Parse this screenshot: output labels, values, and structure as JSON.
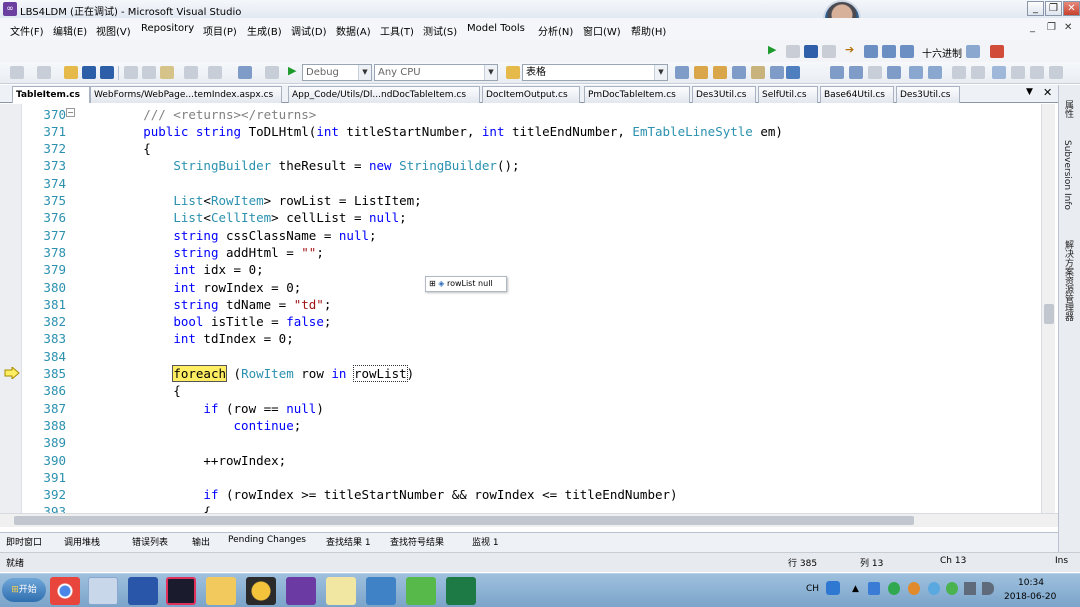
{
  "window": {
    "title": "LBS4LDM (正在调试) - Microsoft Visual Studio",
    "controls": [
      "_",
      "❐",
      "✕"
    ],
    "inner_controls": [
      "_",
      "❐",
      "✕"
    ]
  },
  "menu": [
    "文件(F)",
    "编辑(E)",
    "视图(V)",
    "Repository",
    "项目(P)",
    "生成(B)",
    "调试(D)",
    "数据(A)",
    "工具(T)",
    "测试(S)",
    "Model Tools",
    "分析(N)",
    "窗口(W)",
    "帮助(H)"
  ],
  "toolbar1": {
    "hex_label": "十六进制"
  },
  "toolbar2": {
    "config": "Debug",
    "platform": "Any CPU",
    "find_value": "表格"
  },
  "tabs": [
    {
      "label": "TableItem.cs",
      "active": true
    },
    {
      "label": "WebForms/WebPage...temIndex.aspx.cs"
    },
    {
      "label": "App_Code/Utils/Dl...ndDocTableItem.cs"
    },
    {
      "label": "DocItemOutput.cs"
    },
    {
      "label": "PmDocTableItem.cs"
    },
    {
      "label": "Des3Util.cs"
    },
    {
      "label": "SelfUtil.cs"
    },
    {
      "label": "Base64Util.cs"
    },
    {
      "label": "Des3Util.cs"
    }
  ],
  "tab_controls": {
    "dropdown": "▼",
    "close": "✕"
  },
  "code": {
    "lines": [
      {
        "n": "370",
        "text": "        /// <returns></returns>"
      },
      {
        "n": "371",
        "text": "        public string ToDLHtml(int titleStartNumber, int titleEndNumber, EmTableLineSytle em)"
      },
      {
        "n": "372",
        "text": "        {"
      },
      {
        "n": "373",
        "text": "            StringBuilder theResult = new StringBuilder();"
      },
      {
        "n": "374",
        "text": ""
      },
      {
        "n": "375",
        "text": "            List<RowItem> rowList = ListItem;"
      },
      {
        "n": "376",
        "text": "            List<CellItem> cellList = null;"
      },
      {
        "n": "377",
        "text": "            string cssClassName = null;"
      },
      {
        "n": "378",
        "text": "            string addHtml = \"\";"
      },
      {
        "n": "379",
        "text": "            int idx = 0;"
      },
      {
        "n": "380",
        "text": "            int rowIndex = 0;"
      },
      {
        "n": "381",
        "text": "            string tdName = \"td\";"
      },
      {
        "n": "382",
        "text": "            bool isTitle = false;"
      },
      {
        "n": "383",
        "text": "            int tdIndex = 0;"
      },
      {
        "n": "384",
        "text": ""
      },
      {
        "n": "385",
        "text": "            foreach (RowItem row in rowList)"
      },
      {
        "n": "386",
        "text": "            {"
      },
      {
        "n": "387",
        "text": "                if (row == null)"
      },
      {
        "n": "388",
        "text": "                    continue;"
      },
      {
        "n": "389",
        "text": ""
      },
      {
        "n": "390",
        "text": "                ++rowIndex;"
      },
      {
        "n": "391",
        "text": ""
      },
      {
        "n": "392",
        "text": "                if (rowIndex >= titleStartNumber && rowIndex <= titleEndNumber)"
      },
      {
        "n": "393",
        "text": "                {"
      }
    ],
    "current_line": "385",
    "datatip": {
      "expand": "⊞",
      "name": "rowList",
      "value": "null"
    }
  },
  "right_panel": [
    "属性",
    "Subversion Info",
    "解决方案资源管理器"
  ],
  "bottom_tabs": [
    "即时窗口",
    "调用堆栈",
    "错误列表",
    "输出",
    "Pending Changes",
    "查找结果 1",
    "查找符号结果",
    "监视 1"
  ],
  "status": {
    "ready": "就绪",
    "line": "行 385",
    "col": "列 13",
    "ch": "Ch 13",
    "ins": "Ins"
  },
  "taskbar": {
    "start": "开始",
    "apps": [
      "chrome",
      "vs-debug",
      "infinity",
      "jetbrains",
      "folder",
      "ultraedit",
      "visual-studio",
      "notepad",
      "qq-avatar",
      "wechat",
      "excel"
    ],
    "lang": "CH",
    "time": "10:34",
    "date": "2018-06-20"
  }
}
